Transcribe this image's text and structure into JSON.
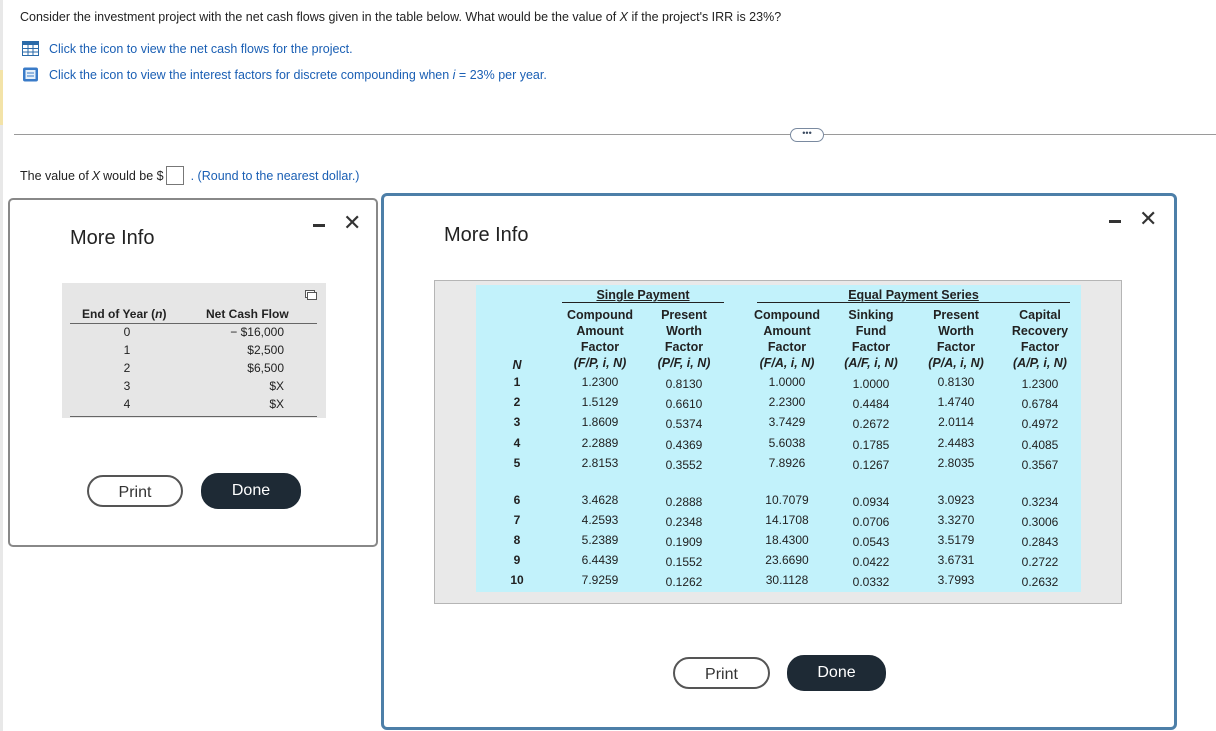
{
  "question": {
    "text_before": "Consider the investment project with the net cash flows given in the table below. What would be the value of ",
    "x_var": "X",
    "text_mid": " if the project's IRR is 23%?",
    "link1": "Click the icon to view the net cash flows for the project.",
    "link2_before": "Click the icon to view the interest factors for discrete compounding when ",
    "link2_var": "i",
    "link2_after": " = 23% per year."
  },
  "divider_button": "•••",
  "answer": {
    "prefix_before": "The value of ",
    "prefix_var": "X",
    "prefix_after": " would be $",
    "input_value": "",
    "hint": ". (Round to the nearest dollar.)"
  },
  "dialog1": {
    "title": "More Info",
    "minimize_icon": "minimize-icon",
    "close_icon": "close-icon",
    "header_year": "End of Year (n)",
    "header_flow": "Net Cash Flow",
    "rows": [
      {
        "year": "0",
        "flow": "− $16,000"
      },
      {
        "year": "1",
        "flow": "$2,500"
      },
      {
        "year": "2",
        "flow": "$6,500"
      },
      {
        "year": "3",
        "flow": "$X"
      },
      {
        "year": "4",
        "flow": "$X"
      }
    ],
    "print_label": "Print",
    "done_label": "Done"
  },
  "dialog2": {
    "title": "More Info",
    "group_single": "Single Payment",
    "group_equal": "Equal Payment Series",
    "n_header": "N",
    "columns": [
      {
        "l1": "Compound",
        "l2": "Amount",
        "l3": "Factor",
        "l4": "(F/P, i, N)"
      },
      {
        "l1": "Present",
        "l2": "Worth",
        "l3": "Factor",
        "l4": "(P/F, i, N)"
      },
      {
        "l1": "Compound",
        "l2": "Amount",
        "l3": "Factor",
        "l4": "(F/A, i, N)"
      },
      {
        "l1": "Sinking",
        "l2": "Fund",
        "l3": "Factor",
        "l4": "(A/F, i, N)"
      },
      {
        "l1": "Present",
        "l2": "Worth",
        "l3": "Factor",
        "l4": "(P/A, i, N)"
      },
      {
        "l1": "Capital",
        "l2": "Recovery",
        "l3": "Factor",
        "l4": "(A/P, i, N)"
      }
    ],
    "rows": [
      {
        "n": "1",
        "v": [
          "1.2300",
          "0.8130",
          "1.0000",
          "1.0000",
          "0.8130",
          "1.2300"
        ]
      },
      {
        "n": "2",
        "v": [
          "1.5129",
          "0.6610",
          "2.2300",
          "0.4484",
          "1.4740",
          "0.6784"
        ]
      },
      {
        "n": "3",
        "v": [
          "1.8609",
          "0.5374",
          "3.7429",
          "0.2672",
          "2.0114",
          "0.4972"
        ]
      },
      {
        "n": "4",
        "v": [
          "2.2889",
          "0.4369",
          "5.6038",
          "0.1785",
          "2.4483",
          "0.4085"
        ]
      },
      {
        "n": "5",
        "v": [
          "2.8153",
          "0.3552",
          "7.8926",
          "0.1267",
          "2.8035",
          "0.3567"
        ]
      },
      {
        "n": "6",
        "v": [
          "3.4628",
          "0.2888",
          "10.7079",
          "0.0934",
          "3.0923",
          "0.3234"
        ]
      },
      {
        "n": "7",
        "v": [
          "4.2593",
          "0.2348",
          "14.1708",
          "0.0706",
          "3.3270",
          "0.3006"
        ]
      },
      {
        "n": "8",
        "v": [
          "5.2389",
          "0.1909",
          "18.4300",
          "0.0543",
          "3.5179",
          "0.2843"
        ]
      },
      {
        "n": "9",
        "v": [
          "6.4439",
          "0.1552",
          "23.6690",
          "0.0422",
          "3.6731",
          "0.2722"
        ]
      },
      {
        "n": "10",
        "v": [
          "7.9259",
          "0.1262",
          "30.1128",
          "0.0332",
          "3.7993",
          "0.2632"
        ]
      }
    ],
    "print_label": "Print",
    "done_label": "Done"
  },
  "colors": {
    "link": "#1a5fb4",
    "table_cyan": "#c2f2fb",
    "table_gray": "#e9e9e9",
    "done_button": "#1e2a35",
    "dialog2_border": "#4d7fa8"
  }
}
